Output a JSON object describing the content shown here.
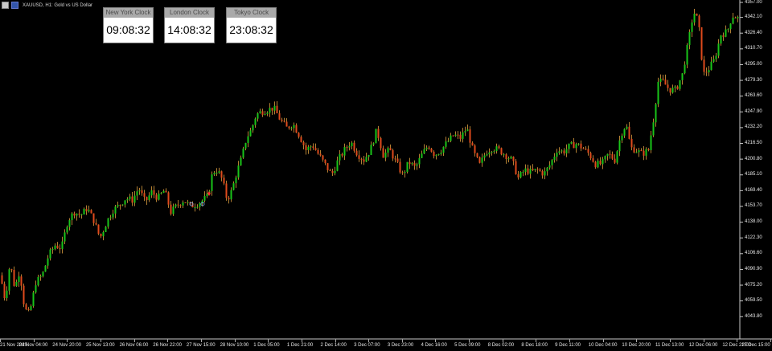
{
  "symbol": {
    "title": "XAUUSD, H1:  Gold vs US Dollar"
  },
  "clocks": [
    {
      "label": "New York Clock",
      "time": "09:08:32"
    },
    {
      "label": "London Clock",
      "time": "14:08:32"
    },
    {
      "label": "Tokyo Clock",
      "time": "23:08:32"
    }
  ],
  "colors": {
    "background": "#000000",
    "bull": "#19c519",
    "bear": "#e04a1c",
    "wick": "#e0a040",
    "axis": "#c8c8c8"
  },
  "chart_data": {
    "type": "candlestick",
    "ylim": [
      4036.0,
      4357.0
    ],
    "y_ticks": [
      "4357.00",
      "4342.10",
      "4326.40",
      "4310.70",
      "4295.00",
      "4279.30",
      "4263.60",
      "4247.90",
      "4232.20",
      "4216.50",
      "4200.80",
      "4185.10",
      "4169.40",
      "4153.70",
      "4138.00",
      "4122.30",
      "4106.60",
      "4090.90",
      "4075.20",
      "4059.50",
      "4043.80"
    ],
    "x_ticks": [
      "21 Nov 2025",
      "24 Nov 04:00",
      "24 Nov 20:00",
      "25 Nov 13:00",
      "26 Nov 06:00",
      "26 Nov 22:00",
      "27 Nov 15:00",
      "28 Nov 10:00",
      "1 Dec 05:00",
      "1 Dec 21:00",
      "2 Dec 14:00",
      "3 Dec 07:00",
      "3 Dec 23:00",
      "4 Dec 16:00",
      "5 Dec 09:00",
      "8 Dec 02:00",
      "8 Dec 18:00",
      "9 Dec 11:00",
      "10 Dec 04:00",
      "10 Dec 20:00",
      "11 Dec 13:00",
      "12 Dec 06:00",
      "12 Dec 22:00",
      "15 Dec 15:00"
    ],
    "close_path": [
      [
        0,
        4085
      ],
      [
        6,
        4060
      ],
      [
        12,
        4098
      ],
      [
        18,
        4072
      ],
      [
        24,
        4090
      ],
      [
        30,
        4052
      ],
      [
        36,
        4046
      ],
      [
        44,
        4078
      ],
      [
        52,
        4085
      ],
      [
        60,
        4105
      ],
      [
        68,
        4115
      ],
      [
        76,
        4112
      ],
      [
        84,
        4140
      ],
      [
        92,
        4148
      ],
      [
        100,
        4145
      ],
      [
        108,
        4152
      ],
      [
        116,
        4140
      ],
      [
        124,
        4122
      ],
      [
        132,
        4138
      ],
      [
        140,
        4150
      ],
      [
        148,
        4155
      ],
      [
        156,
        4162
      ],
      [
        164,
        4160
      ],
      [
        172,
        4172
      ],
      [
        180,
        4158
      ],
      [
        188,
        4168
      ],
      [
        196,
        4162
      ],
      [
        204,
        4170
      ],
      [
        212,
        4148
      ],
      [
        220,
        4155
      ],
      [
        228,
        4160
      ],
      [
        236,
        4154
      ],
      [
        244,
        4156
      ],
      [
        252,
        4160
      ],
      [
        258,
        4164
      ],
      [
        264,
        4188
      ],
      [
        270,
        4190
      ],
      [
        276,
        4180
      ],
      [
        282,
        4160
      ],
      [
        288,
        4170
      ],
      [
        294,
        4188
      ],
      [
        300,
        4202
      ],
      [
        306,
        4222
      ],
      [
        312,
        4230
      ],
      [
        318,
        4245
      ],
      [
        324,
        4248
      ],
      [
        332,
        4250
      ],
      [
        340,
        4252
      ],
      [
        348,
        4240
      ],
      [
        356,
        4232
      ],
      [
        364,
        4236
      ],
      [
        372,
        4224
      ],
      [
        380,
        4210
      ],
      [
        388,
        4215
      ],
      [
        396,
        4205
      ],
      [
        404,
        4195
      ],
      [
        412,
        4185
      ],
      [
        420,
        4200
      ],
      [
        428,
        4210
      ],
      [
        436,
        4218
      ],
      [
        444,
        4206
      ],
      [
        452,
        4200
      ],
      [
        460,
        4210
      ],
      [
        468,
        4230
      ],
      [
        476,
        4205
      ],
      [
        484,
        4210
      ],
      [
        492,
        4198
      ],
      [
        500,
        4185
      ],
      [
        508,
        4198
      ],
      [
        516,
        4192
      ],
      [
        524,
        4205
      ],
      [
        532,
        4215
      ],
      [
        540,
        4205
      ],
      [
        548,
        4210
      ],
      [
        556,
        4218
      ],
      [
        564,
        4225
      ],
      [
        572,
        4222
      ],
      [
        580,
        4232
      ],
      [
        588,
        4208
      ],
      [
        596,
        4195
      ],
      [
        604,
        4208
      ],
      [
        612,
        4212
      ],
      [
        620,
        4210
      ],
      [
        628,
        4205
      ],
      [
        636,
        4200
      ],
      [
        644,
        4182
      ],
      [
        652,
        4190
      ],
      [
        660,
        4188
      ],
      [
        668,
        4190
      ],
      [
        676,
        4186
      ],
      [
        684,
        4196
      ],
      [
        692,
        4210
      ],
      [
        700,
        4208
      ],
      [
        708,
        4214
      ],
      [
        716,
        4216
      ],
      [
        724,
        4212
      ],
      [
        732,
        4206
      ],
      [
        740,
        4196
      ],
      [
        748,
        4196
      ],
      [
        756,
        4206
      ],
      [
        764,
        4200
      ],
      [
        772,
        4226
      ],
      [
        778,
        4236
      ],
      [
        784,
        4212
      ],
      [
        790,
        4210
      ],
      [
        798,
        4206
      ],
      [
        806,
        4210
      ],
      [
        812,
        4240
      ],
      [
        818,
        4278
      ],
      [
        824,
        4278
      ],
      [
        832,
        4270
      ],
      [
        840,
        4270
      ],
      [
        848,
        4285
      ],
      [
        856,
        4320
      ],
      [
        862,
        4348
      ],
      [
        868,
        4338
      ],
      [
        874,
        4285
      ],
      [
        880,
        4290
      ],
      [
        888,
        4300
      ],
      [
        896,
        4325
      ],
      [
        904,
        4328
      ],
      [
        910,
        4344
      ],
      [
        916,
        4342
      ],
      [
        924,
        4336
      ]
    ]
  }
}
